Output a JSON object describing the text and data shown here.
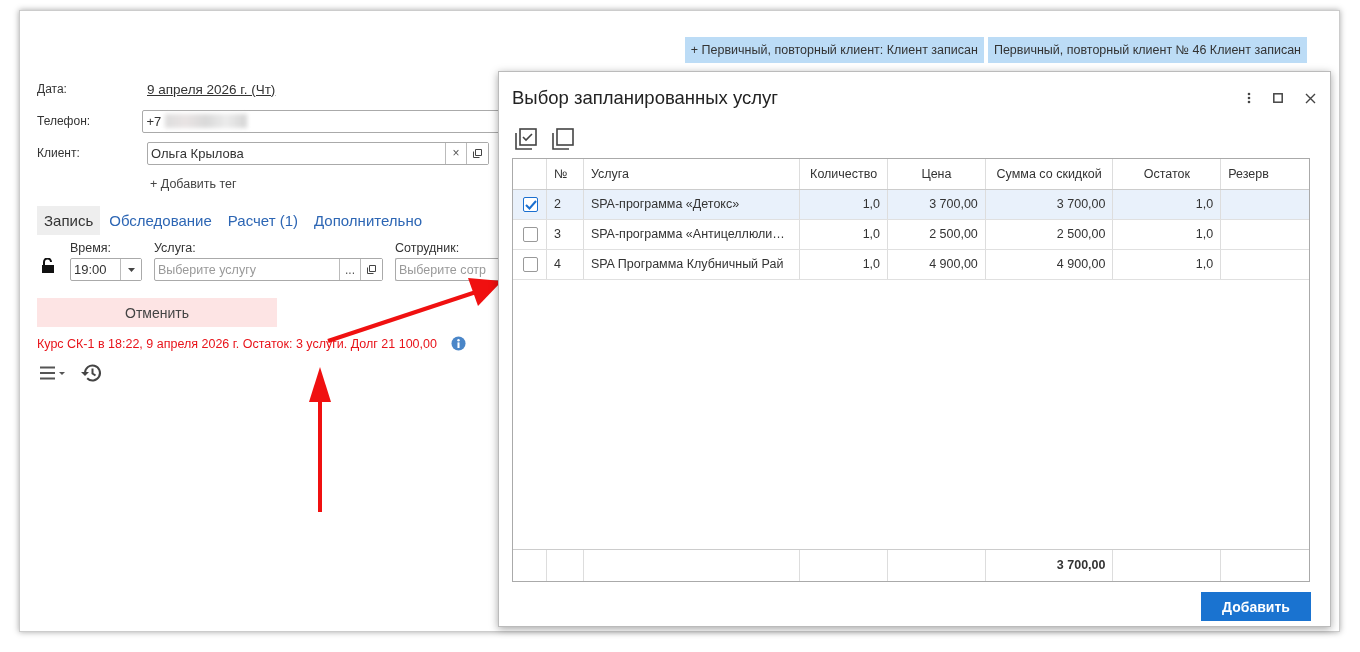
{
  "tags": [
    "+ Первичный, повторный клиент: Клиент записан",
    "Первичный, повторный клиент № 46 Клиент записан"
  ],
  "form": {
    "date_label": "Дата:",
    "date_value": "9 апреля 2026 г. (Чт)",
    "phone_label": "Телефон:",
    "phone_value": "+7",
    "client_label": "Клиент:",
    "client_value": "Ольга Крылова",
    "clear_button": "×",
    "add_tag": "+ Добавить тег"
  },
  "tabs": [
    {
      "label": "Запись",
      "selected": true
    },
    {
      "label": "Обследование",
      "selected": false
    },
    {
      "label": "Расчет (1)",
      "selected": false
    },
    {
      "label": "Дополнительно",
      "selected": false
    }
  ],
  "record": {
    "time_label": "Время:",
    "time_value": "19:00",
    "service_label": "Услуга:",
    "service_placeholder": "Выберите услугу",
    "service_more": "...",
    "employee_label": "Сотрудник:",
    "employee_placeholder": "Выберите сотр",
    "cancel_button": "Отменить",
    "course_info": "Курс СК-1 в 18:22, 9 апреля 2026 г. Остаток: 3 услуги. Долг 21 100,00"
  },
  "dialog": {
    "title": "Выбор запланированных услуг",
    "columns": [
      "№",
      "Услуга",
      "Количество",
      "Цена",
      "Сумма со скидкой",
      "Остаток",
      "Резерв"
    ],
    "rows": [
      {
        "checked": true,
        "selected": true,
        "number": "2",
        "service": "SPA-программа «Детокс»",
        "quantity": "1,0",
        "price": "3 700,00",
        "sum": "3 700,00",
        "rest": "1,0"
      },
      {
        "checked": false,
        "selected": false,
        "number": "3",
        "service": "SPA-программа «Антицеллюли…",
        "quantity": "1,0",
        "price": "2 500,00",
        "sum": "2 500,00",
        "rest": "1,0"
      },
      {
        "checked": false,
        "selected": false,
        "number": "4",
        "service": "SPA Программа Клубничный Рай",
        "quantity": "1,0",
        "price": "4 900,00",
        "sum": "4 900,00",
        "rest": "1,0"
      }
    ],
    "total_sum": "3 700,00",
    "add_button": "Добавить"
  }
}
